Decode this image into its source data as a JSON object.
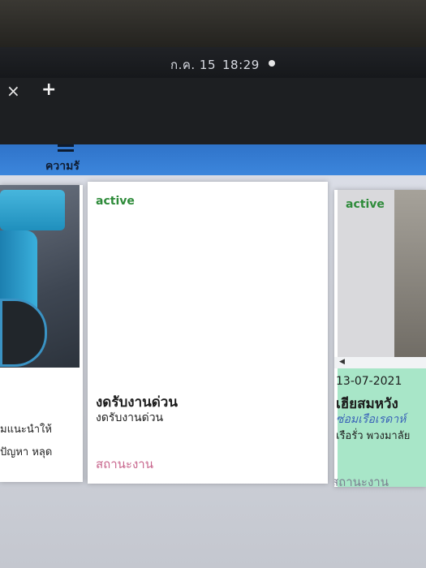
{
  "system": {
    "date": "ก.ค. 15",
    "time": "18:29"
  },
  "tabs": {
    "close_symbol": "×",
    "new_symbol": "+"
  },
  "header": {
    "title": "ความรั"
  },
  "cards": [
    {
      "desc_line1": "มแนะนำให้",
      "desc_line2": "ปัญหา หลุด"
    },
    {
      "status": "active",
      "title": "งดรับงานด่วน",
      "subtitle": "งดรับงานด่วน",
      "footer": "สถานะงาน"
    },
    {
      "status": "active",
      "date": "13-07-2021",
      "title": "เฮียสมหวัง",
      "service": "ซ่อมเรือเรดาห์",
      "desc": "เรือรั่ว พวงมาลัย",
      "footer": "สถานะงาน"
    }
  ],
  "colors": {
    "header_bg": "#3c86dc",
    "status_active": "#2e8b3a",
    "footer_label": "#c8668d",
    "card_highlight": "#a8e6c8"
  }
}
